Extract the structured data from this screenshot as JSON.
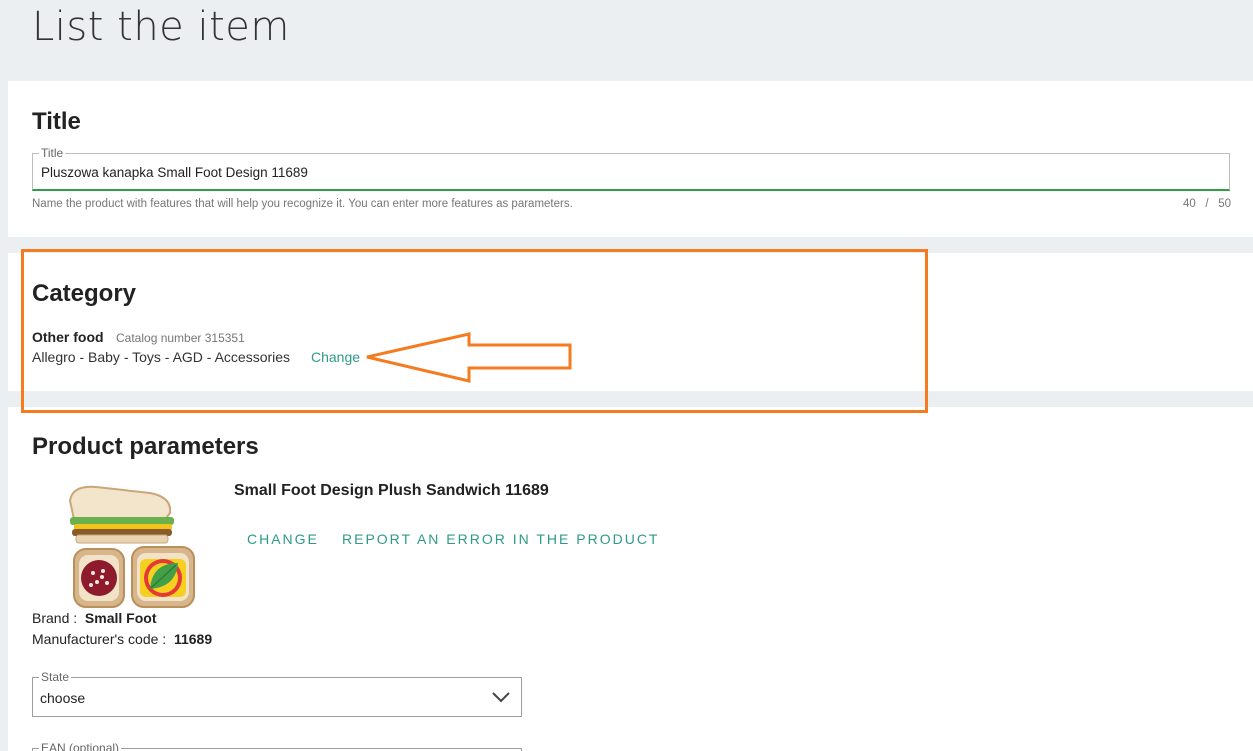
{
  "page": {
    "title": "List the item"
  },
  "title_section": {
    "heading": "Title",
    "field_label": "Title",
    "field_value": "Pluszowa kanapka Small Foot Design 11689",
    "hint": "Name the product with features that will help you recognize it. You can enter more features as parameters.",
    "counter_current": "40",
    "counter_sep": "/",
    "counter_max": "50"
  },
  "category_section": {
    "heading": "Category",
    "name": "Other food",
    "catalog": "Catalog number 315351",
    "path": "Allegro - Baby - Toys - AGD - Accessories",
    "change_label": "Change"
  },
  "annotation": {
    "color": "#f47b20"
  },
  "params_section": {
    "heading": "Product parameters",
    "product_name": "Small Foot Design Plush Sandwich 11689",
    "change_label": "CHANGE",
    "report_label": "REPORT AN ERROR IN THE PRODUCT",
    "brand_label": "Brand :",
    "brand_value": "Small Foot",
    "mfr_label": "Manufacturer's code :",
    "mfr_value": "11689",
    "state_label": "State",
    "state_value": "choose",
    "ean_label": "EAN (optional)"
  },
  "colors": {
    "accent": "#2e9a8a",
    "success_underline": "#2e9e47"
  }
}
